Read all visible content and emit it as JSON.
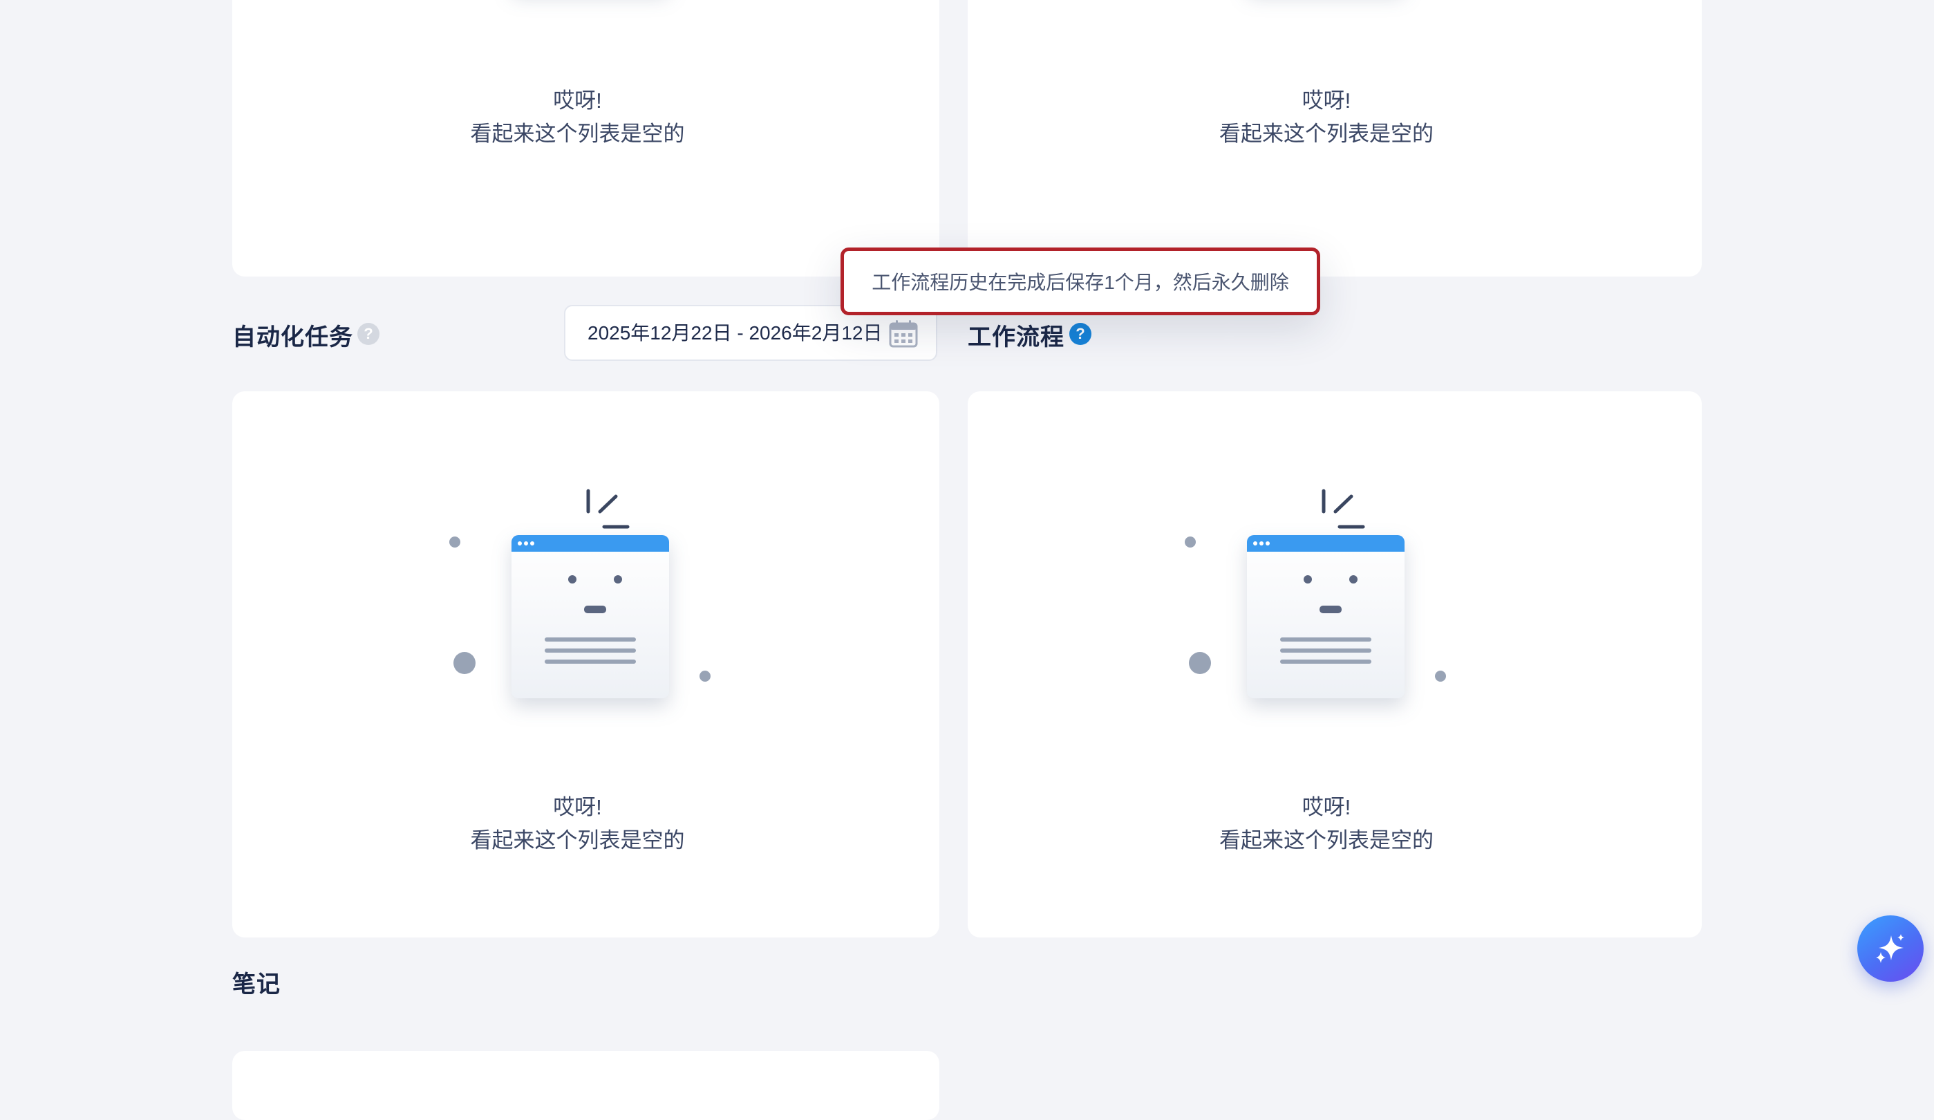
{
  "empty_state": {
    "line1": "哎呀!",
    "line2": "看起来这个列表是空的"
  },
  "automation": {
    "title": "自动化任务",
    "help": "?",
    "date_range": "2025年12月22日 - 2026年2月12日"
  },
  "workflow": {
    "title": "工作流程",
    "help": "?",
    "tooltip": "工作流程历史在完成后保存1个月，然后永久删除"
  },
  "notes": {
    "title": "笔记"
  },
  "icons": {
    "help": "question-mark-icon",
    "calendar": "calendar-icon",
    "assistant": "sparkle-icon",
    "empty": "empty-list-illustration"
  },
  "colors": {
    "background": "#f3f4f8",
    "card": "#ffffff",
    "title": "#1a2747",
    "accent_blue": "#1683d8",
    "tooltip_border": "#b2222a"
  }
}
